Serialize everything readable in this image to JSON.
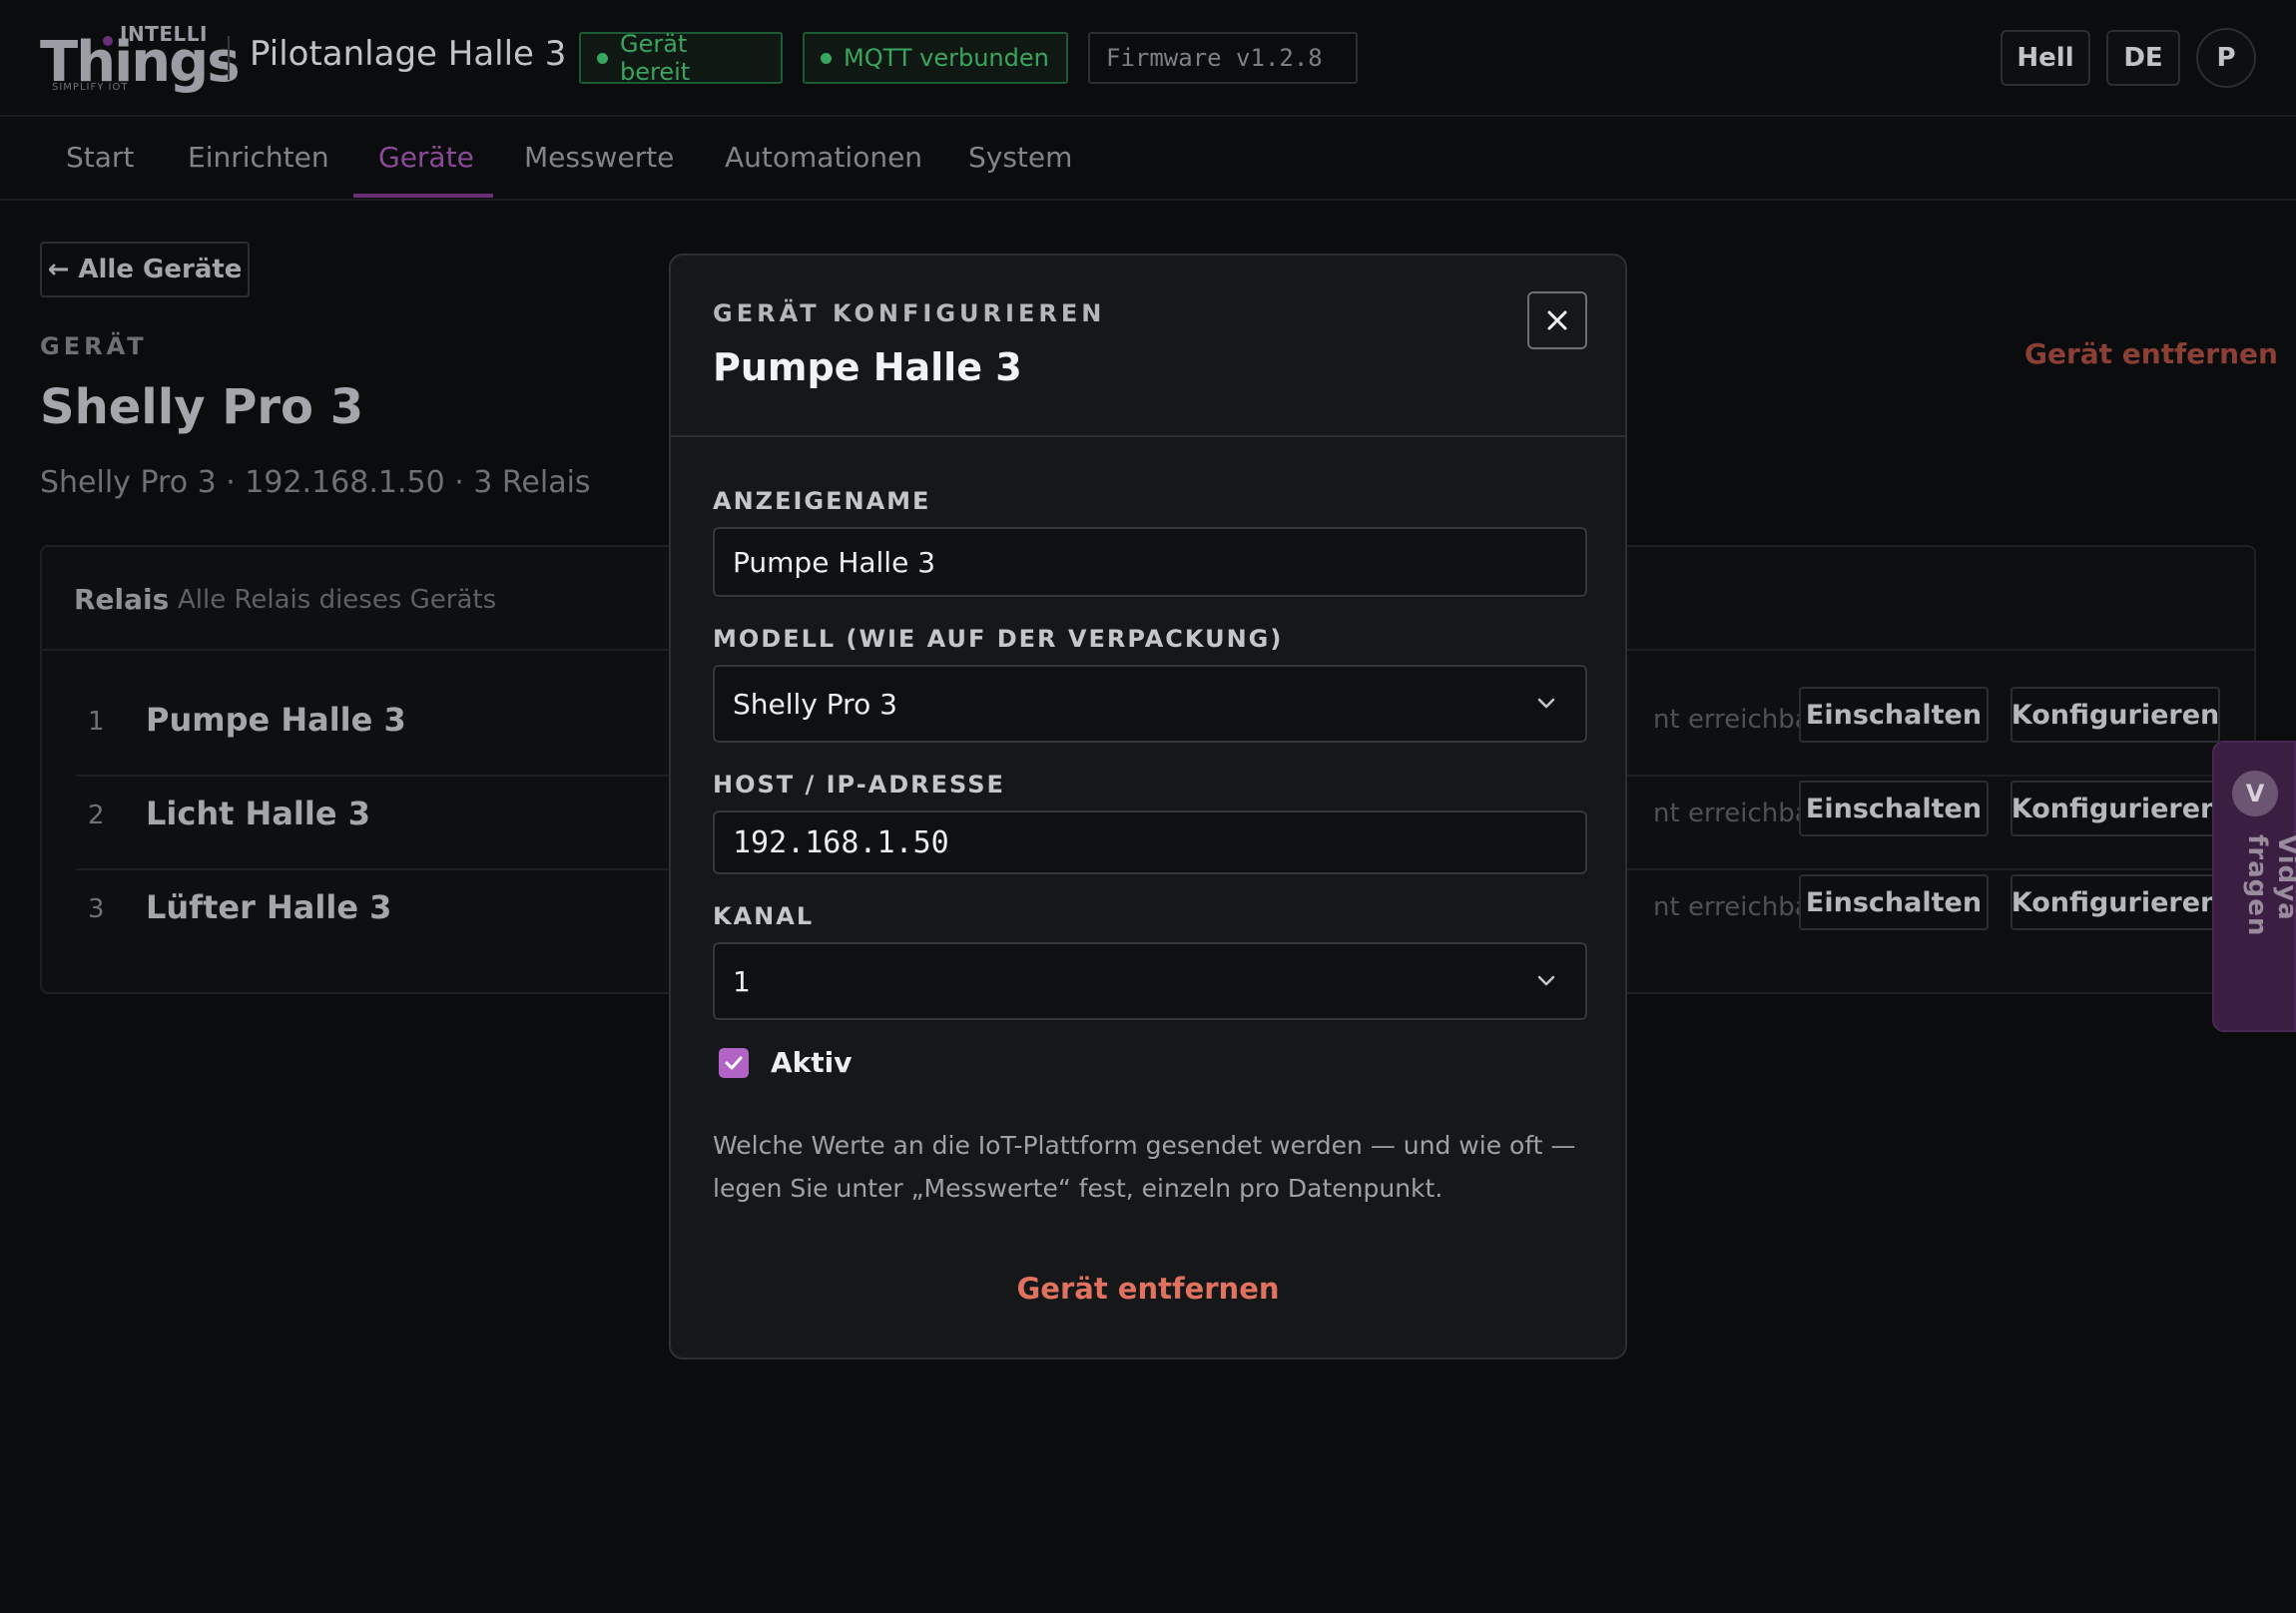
{
  "header": {
    "logo_top": "INTELLI",
    "logo_main": "Things",
    "logo_tagline": "SIMPLIFY IOT",
    "site_title": "Pilotanlage Halle 3",
    "badge_ready": "Gerät bereit",
    "badge_mqtt": "MQTT verbunden",
    "badge_firmware": "Firmware v1.2.8",
    "theme_button": "Hell",
    "lang_button": "DE",
    "avatar_letter": "P"
  },
  "nav": {
    "items": [
      "Start",
      "Einrichten",
      "Geräte",
      "Messwerte",
      "Automationen",
      "System"
    ],
    "active": "Geräte"
  },
  "page": {
    "back_button": "← Alle Geräte",
    "eyebrow": "GERÄT",
    "title": "Shelly Pro 3",
    "meta": "Shelly Pro 3 · 192.168.1.50 · 3 Relais",
    "remove_link": "Gerät entfernen"
  },
  "relais": {
    "title": "Relais",
    "subtitle": "Alle Relais dieses Geräts",
    "rows": [
      {
        "num": "1",
        "name": "Pumpe Halle 3",
        "status": "nt erreichbar",
        "on": "Einschalten",
        "cfg": "Konfigurieren"
      },
      {
        "num": "2",
        "name": "Licht Halle 3",
        "status": "nt erreichbar",
        "on": "Einschalten",
        "cfg": "Konfigurieren"
      },
      {
        "num": "3",
        "name": "Lüfter Halle 3",
        "status": "nt erreichbar",
        "on": "Einschalten",
        "cfg": "Konfigurieren"
      }
    ]
  },
  "assistant": {
    "avatar": "V",
    "label": "Vidya fragen"
  },
  "modal": {
    "eyebrow": "GERÄT KONFIGURIEREN",
    "title": "Pumpe Halle 3",
    "display_name_label": "ANZEIGENAME",
    "display_name_value": "Pumpe Halle 3",
    "model_label": "MODELL (WIE AUF DER VERPACKUNG)",
    "model_value": "Shelly Pro 3",
    "host_label": "HOST / IP-ADRESSE",
    "host_value": "192.168.1.50",
    "channel_label": "KANAL",
    "channel_value": "1",
    "active_label": "Aktiv",
    "active_checked": true,
    "note": "Welche Werte an die IoT-Plattform gesendet werden — und wie oft — legen Sie unter „Messwerte“ fest, einzeln pro Datenpunkt.",
    "remove_button": "Gerät entfernen"
  },
  "colors": {
    "accent": "#b163c6",
    "nav_active": "#8b4a97",
    "success": "#3aa55f",
    "danger": "#e1725f",
    "modal_bg": "#151719",
    "page_bg": "#0b0c0d"
  }
}
